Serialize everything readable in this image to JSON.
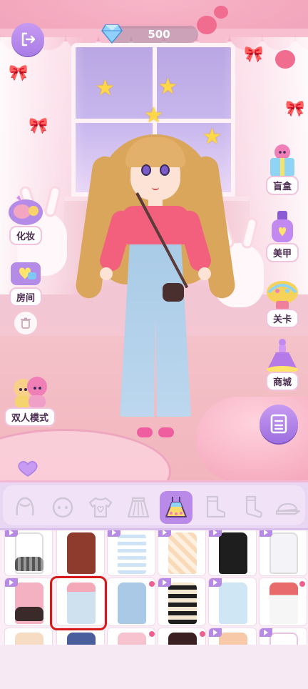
{
  "header": {
    "gem_count": "500"
  },
  "side_menu": {
    "left": [
      {
        "label": "化妆"
      },
      {
        "label": "房间"
      },
      {
        "label": "双人模式"
      }
    ],
    "right": [
      {
        "label": "盲盒"
      },
      {
        "label": "美甲"
      },
      {
        "label": "关卡"
      },
      {
        "label": "商城"
      }
    ]
  },
  "categories": [
    {
      "icon": "hair-icon"
    },
    {
      "icon": "face-icon"
    },
    {
      "icon": "top-icon"
    },
    {
      "icon": "skirt-icon"
    },
    {
      "icon": "dress-icon",
      "active": true
    },
    {
      "icon": "boots-icon"
    },
    {
      "icon": "socks-icon"
    },
    {
      "icon": "hat-icon"
    }
  ],
  "colors": {
    "accent_purple": "#b98ae8",
    "selection_red": "#d61a1a",
    "badge_pink": "#f0608e"
  },
  "selected_item": "outfit-row2-col2"
}
